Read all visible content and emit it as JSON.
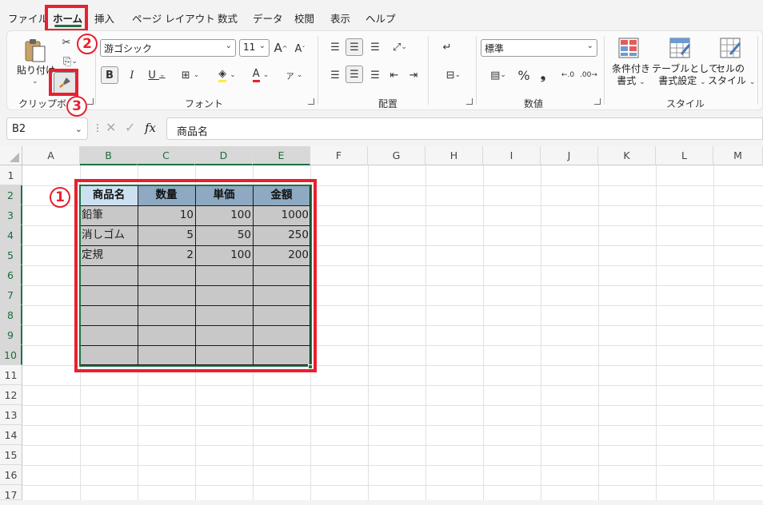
{
  "menu": {
    "tabs": [
      "ファイル",
      "ホーム",
      "挿入",
      "ページ レイアウト",
      "数式",
      "データ",
      "校閲",
      "表示",
      "ヘルプ"
    ],
    "active": "ホーム"
  },
  "ribbon": {
    "clipboard": {
      "paste_label": "貼り付け",
      "group_label": "クリップボード"
    },
    "font": {
      "font_name": "游ゴシック",
      "font_size": "11",
      "group_label": "フォント",
      "bold": "B",
      "italic": "I",
      "underline": "U",
      "grow": "A",
      "shrink": "A",
      "phonetic": "ア",
      "font_color_letter": "A"
    },
    "alignment": {
      "group_label": "配置"
    },
    "number": {
      "format": "標準",
      "percent": "%",
      "comma": "❟",
      "group_label": "数値"
    },
    "styles": {
      "conditional_line1": "条件付き",
      "conditional_line2": "書式",
      "table_line1": "テーブルとして",
      "table_line2": "書式設定",
      "cell_line1": "セルの",
      "cell_line2": "スタイル",
      "group_label": "スタイル"
    }
  },
  "formula_bar": {
    "name_box": "B2",
    "fx": "fx",
    "content": "商品名"
  },
  "columns": [
    "A",
    "B",
    "C",
    "D",
    "E",
    "F",
    "G",
    "H",
    "I",
    "J",
    "K",
    "L",
    "M"
  ],
  "rows": [
    "1",
    "2",
    "3",
    "4",
    "5",
    "6",
    "7",
    "8",
    "9",
    "10",
    "11",
    "12",
    "13",
    "14",
    "15",
    "16",
    "17"
  ],
  "table": {
    "headers": [
      "商品名",
      "数量",
      "単価",
      "金額"
    ],
    "rows": [
      [
        "鉛筆",
        "10",
        "100",
        "1000"
      ],
      [
        "消しゴム",
        "5",
        "50",
        "250"
      ],
      [
        "定規",
        "2",
        "100",
        "200"
      ]
    ]
  },
  "annotations": {
    "one": "1",
    "two": "2",
    "three": "3"
  },
  "colors": {
    "accent_green": "#1e7145",
    "annotation_red": "#e8202f",
    "header_fill": "#8ea9c1",
    "body_fill": "#c8c8c8"
  }
}
